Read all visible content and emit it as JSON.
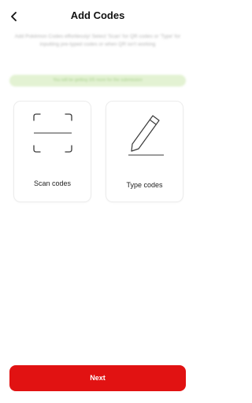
{
  "header": {
    "title": "Add Codes",
    "back_icon": "chevron-left-icon"
  },
  "description": "Add Pokémon Codes effortlessly! Select 'Scan' for QR codes or 'Type' for inputting pre-typed codes or when QR isn't working",
  "info_banner": {
    "text": "You will be getting 3/5 more for the submission"
  },
  "options": [
    {
      "label": "Scan codes",
      "icon": "scan-frame-icon"
    },
    {
      "label": "Type codes",
      "icon": "pencil-icon"
    }
  ],
  "next_button": {
    "label": "Next"
  },
  "colors": {
    "accent": "#e11212",
    "banner_bg": "#e3f2d3",
    "banner_text": "#a6cf8a",
    "muted_text": "#b5b5b5",
    "card_border": "#ececec"
  }
}
